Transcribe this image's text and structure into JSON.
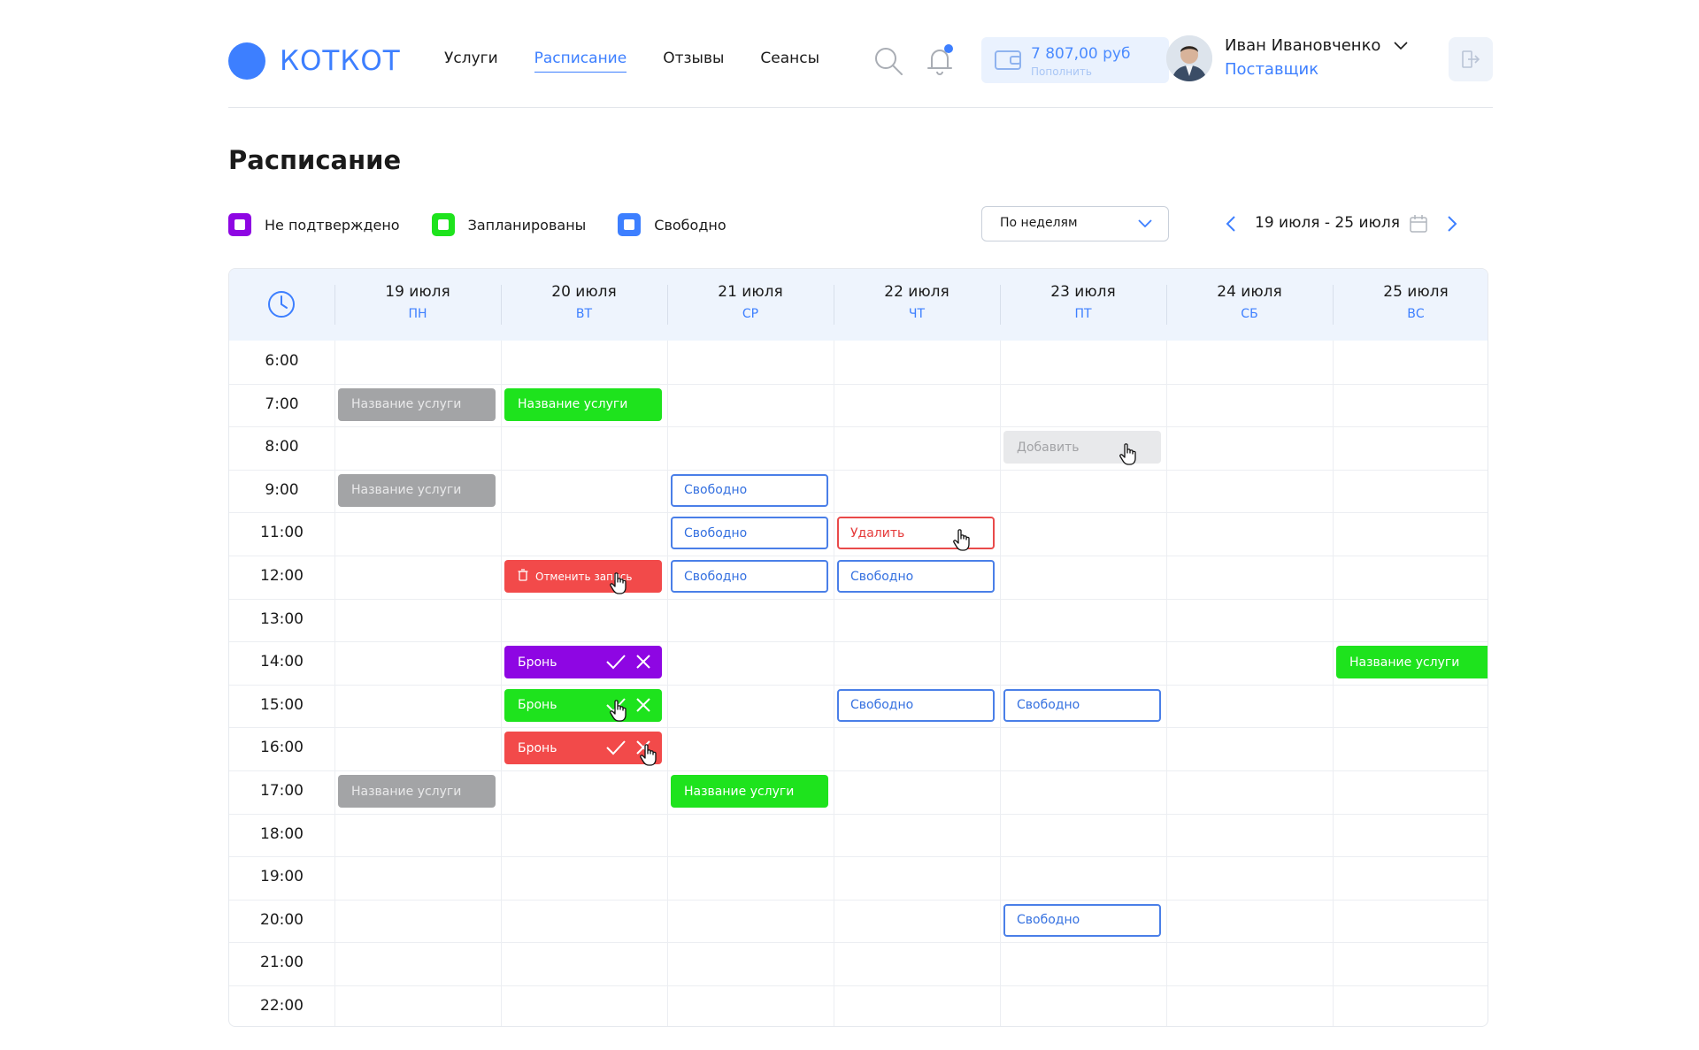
{
  "brand": {
    "name": "КОТКОТ",
    "color": "#3d7fff"
  },
  "nav": [
    {
      "label": "Услуги",
      "active": false
    },
    {
      "label": "Расписание",
      "active": true
    },
    {
      "label": "Отзывы",
      "active": false
    },
    {
      "label": "Сеансы",
      "active": false
    }
  ],
  "wallet": {
    "amount": "7 807,00 руб",
    "topup_label": "Пополнить"
  },
  "user": {
    "name": "Иван Ивановченко",
    "role": "Поставщик"
  },
  "page_title": "Расписание",
  "legend": [
    {
      "label": "Не подтверждено",
      "color": "#8e06e3"
    },
    {
      "label": "Запланированы",
      "color": "#1ee31d"
    },
    {
      "label": "Свободно",
      "color": "#3d7fff"
    }
  ],
  "view_select": {
    "value": "По неделям"
  },
  "date_range": "19 июля - 25 июля",
  "days": [
    {
      "date": "19 июля",
      "short": "ПН"
    },
    {
      "date": "20 июля",
      "short": "ВТ"
    },
    {
      "date": "21 июля",
      "short": "СР"
    },
    {
      "date": "22 июля",
      "short": "ЧТ"
    },
    {
      "date": "23 июля",
      "short": "ПТ"
    },
    {
      "date": "24 июля",
      "short": "СБ"
    },
    {
      "date": "25 июля",
      "short": "ВС"
    }
  ],
  "times": [
    "6:00",
    "7:00",
    "8:00",
    "9:00",
    "11:00",
    "12:00",
    "13:00",
    "14:00",
    "15:00",
    "16:00",
    "17:00",
    "18:00",
    "19:00",
    "20:00",
    "21:00",
    "22:00"
  ],
  "events": [
    {
      "day": 0,
      "row": 1,
      "label": "Название услуги",
      "kind": "gray"
    },
    {
      "day": 1,
      "row": 1,
      "label": "Название услуги",
      "kind": "green"
    },
    {
      "day": 4,
      "row": 2,
      "label": "Добавить",
      "kind": "add",
      "cursor": true
    },
    {
      "day": 0,
      "row": 3,
      "label": "Название услуги",
      "kind": "gray"
    },
    {
      "day": 2,
      "row": 3,
      "label": "Свободно",
      "kind": "free"
    },
    {
      "day": 2,
      "row": 4,
      "label": "Свободно",
      "kind": "free"
    },
    {
      "day": 3,
      "row": 4,
      "label": "Удалить",
      "kind": "delete",
      "cursor": true
    },
    {
      "day": 1,
      "row": 5,
      "label": "Отменить запись",
      "kind": "red",
      "trash": true,
      "cursor": true
    },
    {
      "day": 2,
      "row": 5,
      "label": "Свободно",
      "kind": "free"
    },
    {
      "day": 3,
      "row": 5,
      "label": "Свободно",
      "kind": "free"
    },
    {
      "day": 1,
      "row": 7,
      "label": "Бронь",
      "kind": "purple",
      "actions": true
    },
    {
      "day": 6,
      "row": 7,
      "label": "Название услуги",
      "kind": "green"
    },
    {
      "day": 1,
      "row": 8,
      "label": "Бронь",
      "kind": "green",
      "actions": true,
      "cursor": true
    },
    {
      "day": 3,
      "row": 8,
      "label": "Свободно",
      "kind": "free"
    },
    {
      "day": 4,
      "row": 8,
      "label": "Свободно",
      "kind": "free"
    },
    {
      "day": 1,
      "row": 9,
      "label": "Бронь",
      "kind": "red",
      "actions": true,
      "cursor": true
    },
    {
      "day": 0,
      "row": 10,
      "label": "Название услуги",
      "kind": "gray"
    },
    {
      "day": 2,
      "row": 10,
      "label": "Название услуги",
      "kind": "green"
    },
    {
      "day": 4,
      "row": 13,
      "label": "Свободно",
      "kind": "free"
    }
  ]
}
